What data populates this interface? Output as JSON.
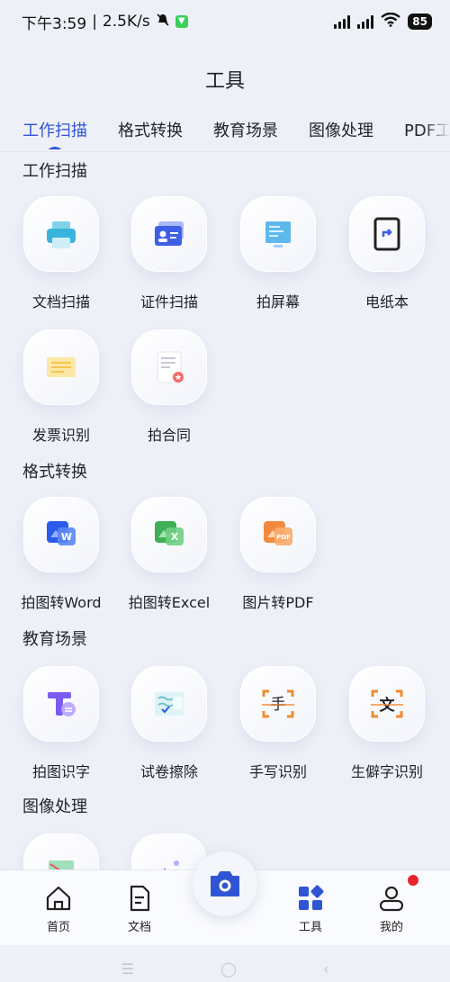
{
  "status_bar": {
    "time": "下午3:59",
    "speed": "2.5K/s",
    "battery": "85"
  },
  "header": {
    "title": "工具"
  },
  "tabs": [
    "工作扫描",
    "格式转换",
    "教育场景",
    "图像处理",
    "PDF工"
  ],
  "sections": {
    "work_scan": {
      "title": "工作扫描",
      "items": [
        "文档扫描",
        "证件扫描",
        "拍屏幕",
        "电纸本",
        "发票识别",
        "拍合同"
      ]
    },
    "format_convert": {
      "title": "格式转换",
      "items": [
        "拍图转Word",
        "拍图转Excel",
        "图片转PDF"
      ]
    },
    "education": {
      "title": "教育场景",
      "items": [
        "拍图识字",
        "试卷擦除",
        "手写识别",
        "生僻字识别"
      ]
    },
    "image_process": {
      "title": "图像处理"
    }
  },
  "bottom_nav": {
    "home": "首页",
    "docs": "文档",
    "tools": "工具",
    "mine": "我的"
  },
  "colors": {
    "accent": "#2f55d4",
    "background": "#eef0f7",
    "notification_dot": "#e8232d"
  }
}
